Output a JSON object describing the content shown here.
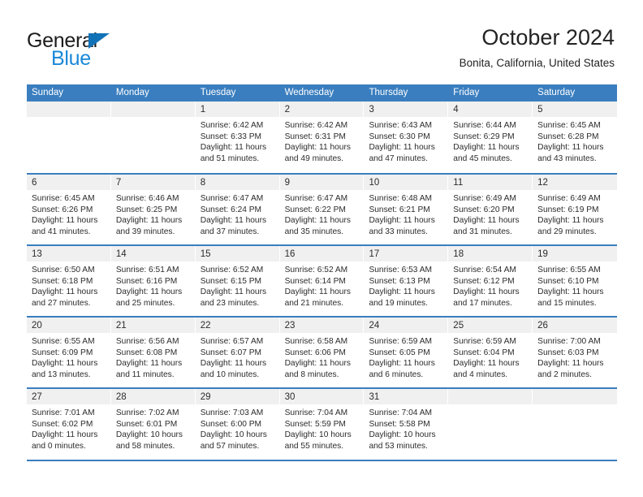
{
  "logo": {
    "text_primary": "General",
    "text_secondary": "Blue",
    "triangle_icon": "triangle-icon",
    "brand_blue": "#1a88d9",
    "triangle_blue": "#1272b8"
  },
  "header": {
    "title": "October 2024",
    "subtitle": "Bonita, California, United States"
  },
  "theme": {
    "header_blue": "#3a7ebf",
    "daynum_strip_gray": "#f0f0f0",
    "text_color": "#2b2b2b"
  },
  "calendar": {
    "weekday_headers": [
      "Sunday",
      "Monday",
      "Tuesday",
      "Wednesday",
      "Thursday",
      "Friday",
      "Saturday"
    ],
    "weeks": [
      [
        {
          "day": "",
          "lines": []
        },
        {
          "day": "",
          "lines": []
        },
        {
          "day": "1",
          "lines": [
            "Sunrise: 6:42 AM",
            "Sunset: 6:33 PM",
            "Daylight: 11 hours",
            "and 51 minutes."
          ]
        },
        {
          "day": "2",
          "lines": [
            "Sunrise: 6:42 AM",
            "Sunset: 6:31 PM",
            "Daylight: 11 hours",
            "and 49 minutes."
          ]
        },
        {
          "day": "3",
          "lines": [
            "Sunrise: 6:43 AM",
            "Sunset: 6:30 PM",
            "Daylight: 11 hours",
            "and 47 minutes."
          ]
        },
        {
          "day": "4",
          "lines": [
            "Sunrise: 6:44 AM",
            "Sunset: 6:29 PM",
            "Daylight: 11 hours",
            "and 45 minutes."
          ]
        },
        {
          "day": "5",
          "lines": [
            "Sunrise: 6:45 AM",
            "Sunset: 6:28 PM",
            "Daylight: 11 hours",
            "and 43 minutes."
          ]
        }
      ],
      [
        {
          "day": "6",
          "lines": [
            "Sunrise: 6:45 AM",
            "Sunset: 6:26 PM",
            "Daylight: 11 hours",
            "and 41 minutes."
          ]
        },
        {
          "day": "7",
          "lines": [
            "Sunrise: 6:46 AM",
            "Sunset: 6:25 PM",
            "Daylight: 11 hours",
            "and 39 minutes."
          ]
        },
        {
          "day": "8",
          "lines": [
            "Sunrise: 6:47 AM",
            "Sunset: 6:24 PM",
            "Daylight: 11 hours",
            "and 37 minutes."
          ]
        },
        {
          "day": "9",
          "lines": [
            "Sunrise: 6:47 AM",
            "Sunset: 6:22 PM",
            "Daylight: 11 hours",
            "and 35 minutes."
          ]
        },
        {
          "day": "10",
          "lines": [
            "Sunrise: 6:48 AM",
            "Sunset: 6:21 PM",
            "Daylight: 11 hours",
            "and 33 minutes."
          ]
        },
        {
          "day": "11",
          "lines": [
            "Sunrise: 6:49 AM",
            "Sunset: 6:20 PM",
            "Daylight: 11 hours",
            "and 31 minutes."
          ]
        },
        {
          "day": "12",
          "lines": [
            "Sunrise: 6:49 AM",
            "Sunset: 6:19 PM",
            "Daylight: 11 hours",
            "and 29 minutes."
          ]
        }
      ],
      [
        {
          "day": "13",
          "lines": [
            "Sunrise: 6:50 AM",
            "Sunset: 6:18 PM",
            "Daylight: 11 hours",
            "and 27 minutes."
          ]
        },
        {
          "day": "14",
          "lines": [
            "Sunrise: 6:51 AM",
            "Sunset: 6:16 PM",
            "Daylight: 11 hours",
            "and 25 minutes."
          ]
        },
        {
          "day": "15",
          "lines": [
            "Sunrise: 6:52 AM",
            "Sunset: 6:15 PM",
            "Daylight: 11 hours",
            "and 23 minutes."
          ]
        },
        {
          "day": "16",
          "lines": [
            "Sunrise: 6:52 AM",
            "Sunset: 6:14 PM",
            "Daylight: 11 hours",
            "and 21 minutes."
          ]
        },
        {
          "day": "17",
          "lines": [
            "Sunrise: 6:53 AM",
            "Sunset: 6:13 PM",
            "Daylight: 11 hours",
            "and 19 minutes."
          ]
        },
        {
          "day": "18",
          "lines": [
            "Sunrise: 6:54 AM",
            "Sunset: 6:12 PM",
            "Daylight: 11 hours",
            "and 17 minutes."
          ]
        },
        {
          "day": "19",
          "lines": [
            "Sunrise: 6:55 AM",
            "Sunset: 6:10 PM",
            "Daylight: 11 hours",
            "and 15 minutes."
          ]
        }
      ],
      [
        {
          "day": "20",
          "lines": [
            "Sunrise: 6:55 AM",
            "Sunset: 6:09 PM",
            "Daylight: 11 hours",
            "and 13 minutes."
          ]
        },
        {
          "day": "21",
          "lines": [
            "Sunrise: 6:56 AM",
            "Sunset: 6:08 PM",
            "Daylight: 11 hours",
            "and 11 minutes."
          ]
        },
        {
          "day": "22",
          "lines": [
            "Sunrise: 6:57 AM",
            "Sunset: 6:07 PM",
            "Daylight: 11 hours",
            "and 10 minutes."
          ]
        },
        {
          "day": "23",
          "lines": [
            "Sunrise: 6:58 AM",
            "Sunset: 6:06 PM",
            "Daylight: 11 hours",
            "and 8 minutes."
          ]
        },
        {
          "day": "24",
          "lines": [
            "Sunrise: 6:59 AM",
            "Sunset: 6:05 PM",
            "Daylight: 11 hours",
            "and 6 minutes."
          ]
        },
        {
          "day": "25",
          "lines": [
            "Sunrise: 6:59 AM",
            "Sunset: 6:04 PM",
            "Daylight: 11 hours",
            "and 4 minutes."
          ]
        },
        {
          "day": "26",
          "lines": [
            "Sunrise: 7:00 AM",
            "Sunset: 6:03 PM",
            "Daylight: 11 hours",
            "and 2 minutes."
          ]
        }
      ],
      [
        {
          "day": "27",
          "lines": [
            "Sunrise: 7:01 AM",
            "Sunset: 6:02 PM",
            "Daylight: 11 hours",
            "and 0 minutes."
          ]
        },
        {
          "day": "28",
          "lines": [
            "Sunrise: 7:02 AM",
            "Sunset: 6:01 PM",
            "Daylight: 10 hours",
            "and 58 minutes."
          ]
        },
        {
          "day": "29",
          "lines": [
            "Sunrise: 7:03 AM",
            "Sunset: 6:00 PM",
            "Daylight: 10 hours",
            "and 57 minutes."
          ]
        },
        {
          "day": "30",
          "lines": [
            "Sunrise: 7:04 AM",
            "Sunset: 5:59 PM",
            "Daylight: 10 hours",
            "and 55 minutes."
          ]
        },
        {
          "day": "31",
          "lines": [
            "Sunrise: 7:04 AM",
            "Sunset: 5:58 PM",
            "Daylight: 10 hours",
            "and 53 minutes."
          ]
        },
        {
          "day": "",
          "lines": []
        },
        {
          "day": "",
          "lines": []
        }
      ]
    ]
  }
}
